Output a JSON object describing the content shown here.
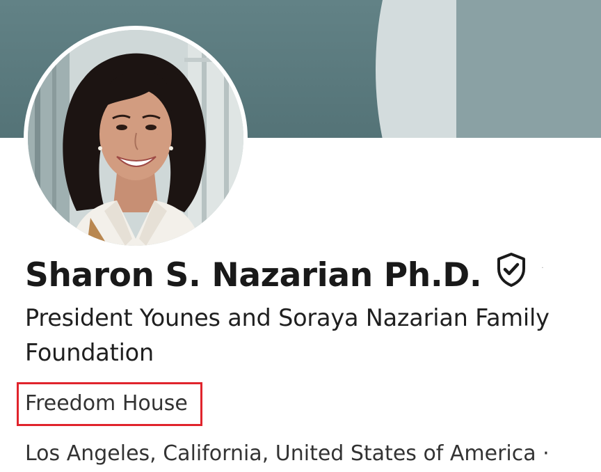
{
  "profile": {
    "name": "Sharon S. Nazarian Ph.D.",
    "verified_icon": "shield-check-icon",
    "headline": "President Younes and Soraya Nazarian Family Foundation",
    "company": "Freedom House",
    "location": "Los Angeles, California, United States of America ·",
    "avatar_icon": "profile-photo"
  },
  "colors": {
    "banner": "#5e7f85",
    "highlight_box": "#e0242c",
    "name_text": "#191919"
  }
}
